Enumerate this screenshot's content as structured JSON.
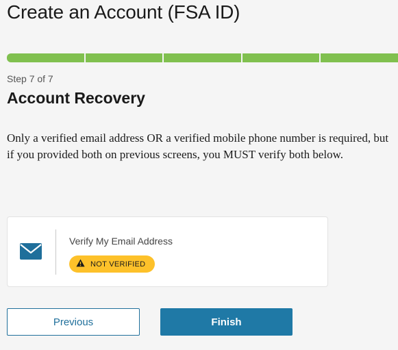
{
  "header": {
    "title": "Create an Account (FSA ID)"
  },
  "progress": {
    "current_step": 7,
    "total_steps": 7,
    "segments": 5,
    "color": "#80c04f"
  },
  "step": {
    "label": "Step 7 of 7"
  },
  "section": {
    "title": "Account Recovery"
  },
  "intro": {
    "text": "Only a verified email address OR a verified mobile phone number is required, but if you provided both on previous screens, you MUST verify both below."
  },
  "email_card": {
    "icon": "envelope-icon",
    "label": "Verify My Email Address",
    "status_icon": "warning-icon",
    "status": "NOT VERIFIED",
    "status_color": "#fdc12a"
  },
  "actions": {
    "previous_label": "Previous",
    "finish_label": "Finish",
    "primary_color": "#1f79a6"
  }
}
